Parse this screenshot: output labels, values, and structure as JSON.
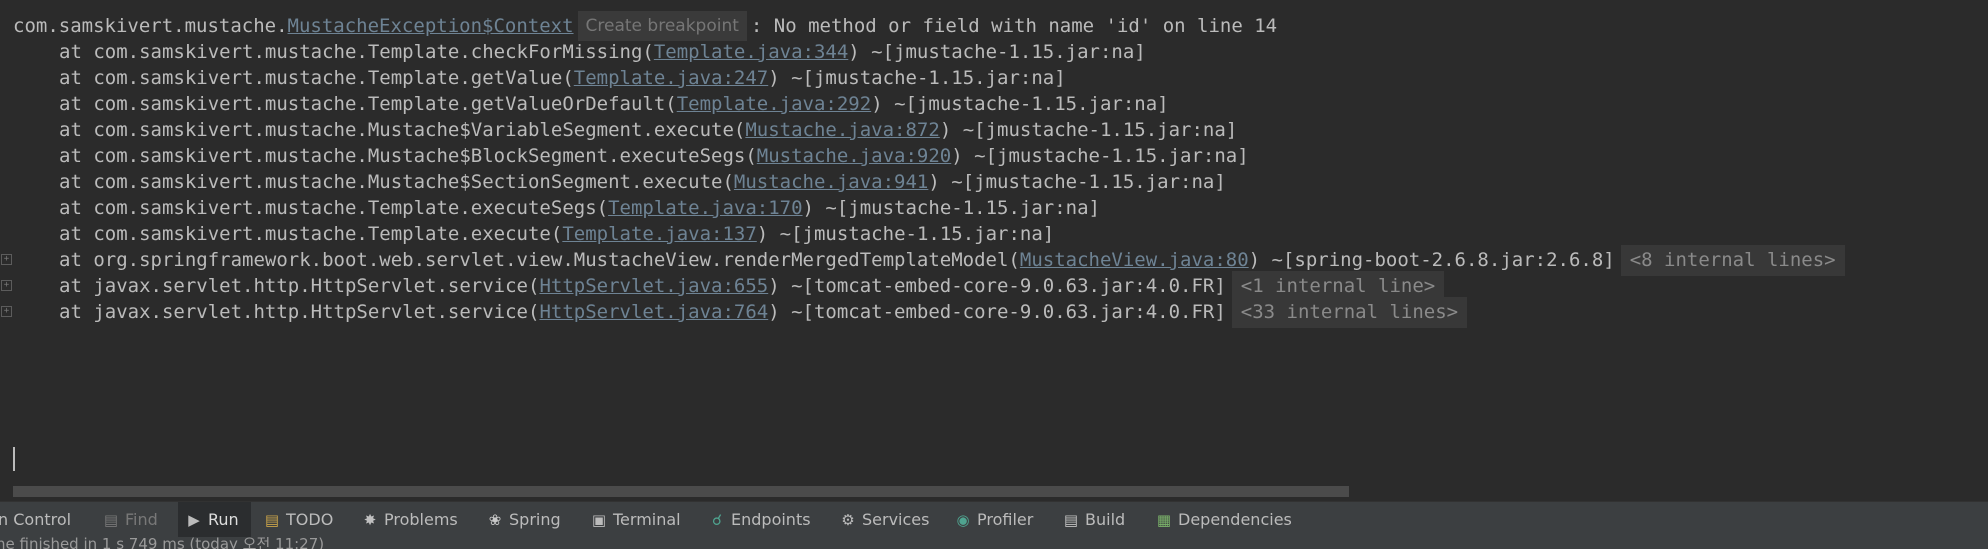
{
  "console": {
    "exception": {
      "prefix": "com.samskivert.mustache.",
      "link": "MustacheException$Context",
      "hint": "Create breakpoint",
      "message": ": No method or field with name 'id' on line 14"
    },
    "frames": [
      {
        "text": "at com.samskivert.mustache.Template.checkForMissing(",
        "link": "Template.java:344",
        "suffix": ") ~[jmustache-1.15.jar:na]"
      },
      {
        "text": "at com.samskivert.mustache.Template.getValue(",
        "link": "Template.java:247",
        "suffix": ") ~[jmustache-1.15.jar:na]"
      },
      {
        "text": "at com.samskivert.mustache.Template.getValueOrDefault(",
        "link": "Template.java:292",
        "suffix": ") ~[jmustache-1.15.jar:na]"
      },
      {
        "text": "at com.samskivert.mustache.Mustache$VariableSegment.execute(",
        "link": "Mustache.java:872",
        "suffix": ") ~[jmustache-1.15.jar:na]"
      },
      {
        "text": "at com.samskivert.mustache.Mustache$BlockSegment.executeSegs(",
        "link": "Mustache.java:920",
        "suffix": ") ~[jmustache-1.15.jar:na]"
      },
      {
        "text": "at com.samskivert.mustache.Mustache$SectionSegment.execute(",
        "link": "Mustache.java:941",
        "suffix": ") ~[jmustache-1.15.jar:na]"
      },
      {
        "text": "at com.samskivert.mustache.Template.executeSegs(",
        "link": "Template.java:170",
        "suffix": ") ~[jmustache-1.15.jar:na]"
      },
      {
        "text": "at com.samskivert.mustache.Template.execute(",
        "link": "Template.java:137",
        "suffix": ") ~[jmustache-1.15.jar:na]"
      },
      {
        "text": "at org.springframework.boot.web.servlet.view.MustacheView.renderMergedTemplateModel(",
        "link": "MustacheView.java:80",
        "suffix": ") ~[spring-boot-2.6.8.jar:2.6.8]",
        "internal": "<8 internal lines>"
      },
      {
        "text": "at javax.servlet.http.HttpServlet.service(",
        "link": "HttpServlet.java:655",
        "suffix": ") ~[tomcat-embed-core-9.0.63.jar:4.0.FR]",
        "internal": "<1 internal line>"
      },
      {
        "text": "at javax.servlet.http.HttpServlet.service(",
        "link": "HttpServlet.java:764",
        "suffix": ") ~[tomcat-embed-core-9.0.63.jar:4.0.FR]",
        "internal": "<33 internal lines>"
      }
    ]
  },
  "toolbar": {
    "items": [
      {
        "label": "n Control",
        "icon": "version-control-icon"
      },
      {
        "label": "Find",
        "icon": "find-icon"
      },
      {
        "label": "Run",
        "icon": "run-icon"
      },
      {
        "label": "TODO",
        "icon": "todo-icon"
      },
      {
        "label": "Problems",
        "icon": "problems-icon"
      },
      {
        "label": "Spring",
        "icon": "spring-icon"
      },
      {
        "label": "Terminal",
        "icon": "terminal-icon"
      },
      {
        "label": "Endpoints",
        "icon": "endpoints-icon"
      },
      {
        "label": "Services",
        "icon": "services-icon"
      },
      {
        "label": "Profiler",
        "icon": "profiler-icon"
      },
      {
        "label": "Build",
        "icon": "build-icon"
      },
      {
        "label": "Dependencies",
        "icon": "dependencies-icon"
      }
    ],
    "active": "Run"
  },
  "status": {
    "text": "ne finished in 1 s 749 ms (today 오전 11:27)"
  },
  "colors": {
    "background": "#2b2b2b",
    "text": "#bbbbbb",
    "link": "#6e8394",
    "toolbar": "#3c3f41"
  }
}
